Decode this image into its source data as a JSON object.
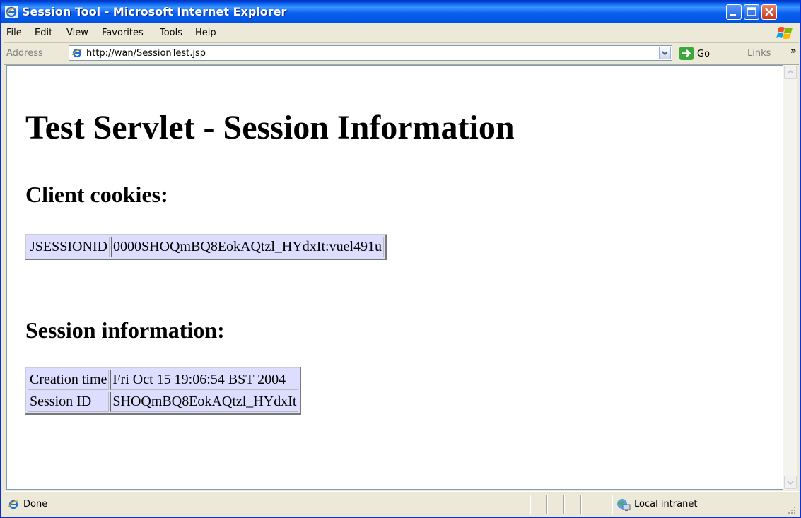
{
  "window": {
    "title": "Session Tool - Microsoft Internet Explorer"
  },
  "menu": {
    "items": [
      "File",
      "Edit",
      "View",
      "Favorites",
      "Tools",
      "Help"
    ]
  },
  "address": {
    "label": "Address",
    "url": "http://wan/SessionTest.jsp",
    "go_label": "Go",
    "links_label": "Links",
    "chevron": "»"
  },
  "page": {
    "heading": "Test Servlet - Session Information",
    "cookies_heading": "Client cookies:",
    "cookies": [
      {
        "name": "JSESSIONID",
        "value": "0000SHOQmBQ8EokAQtzl_HYdxIt:vuel491u"
      }
    ],
    "session_heading": "Session information:",
    "session": [
      {
        "name": "Creation time",
        "value": "Fri Oct 15 19:06:54 BST 2004"
      },
      {
        "name": "Session ID",
        "value": "SHOQmBQ8EokAQtzl_HYdxIt"
      }
    ]
  },
  "status": {
    "text": "Done",
    "zone": "Local intranet"
  },
  "colors": {
    "table_bg": "#ddddff",
    "titlebar": "#0058ee"
  }
}
